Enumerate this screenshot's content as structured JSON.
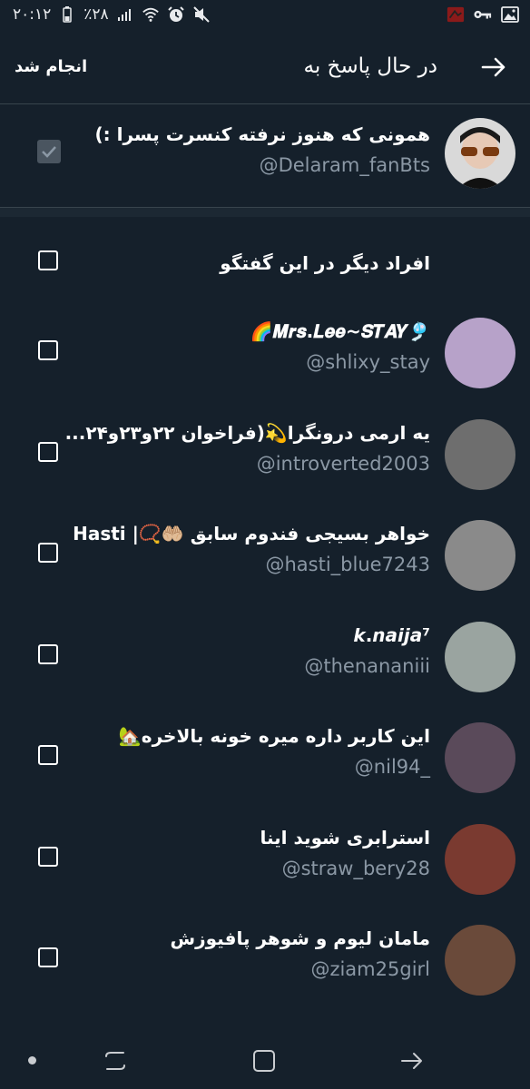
{
  "status_bar": {
    "time": "۲۰:۱۲",
    "battery": "٪۲۸"
  },
  "header": {
    "title": "در حال پاسخ به",
    "done_label": "انجام شد"
  },
  "recipient": {
    "name": "همونی که هنوز نرفته کنسرت پسرا :)",
    "handle": "@Delaram_fanBts",
    "checked": true
  },
  "others": {
    "label": "افراد دیگر در این گفتگو"
  },
  "users": [
    {
      "name": "🎐𝑴𝒓𝒔.𝑳𝒆𝒆~𝑺𝑻𝑨𝒀🌈",
      "handle": "@shlixy_stay",
      "avatar_color": "#b7a2c9"
    },
    {
      "name": "یه ارمی درونگرا💫(فراخوان ۲۲و۲۳و۲۴...",
      "handle": "@introverted2003",
      "avatar_color": "#6e6e6e"
    },
    {
      "name": "خواهر بسیجی فندوم سابق 🤲🏼📿| 𝗛𝗮𝘀𝘁𝗶",
      "handle": "@hasti_blue7243",
      "avatar_color": "#8a8a8a"
    },
    {
      "name": "𝙠.𝙣𝙖𝙞𝙟𝙖⁷",
      "handle": "@thenananiii",
      "avatar_color": "#9aa4a0"
    },
    {
      "name": "این کاربر داره میره خونه بالاخره🏡",
      "handle": "@nil94_",
      "avatar_color": "#5a4a5a"
    },
    {
      "name": "استرابری شوید اینا",
      "handle": "@straw_bery28",
      "avatar_color": "#7a3a30"
    },
    {
      "name": "مامان لیوم و شوهر پافیوزش",
      "handle": "@ziam25girl",
      "avatar_color": "#6a4a3a"
    }
  ]
}
